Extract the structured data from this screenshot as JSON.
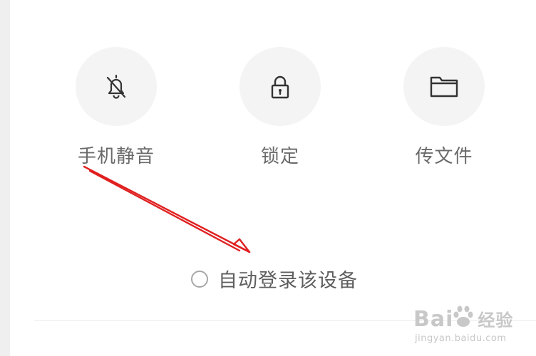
{
  "actions": [
    {
      "label": "手机静音",
      "icon": "bell-off-icon"
    },
    {
      "label": "锁定",
      "icon": "lock-icon"
    },
    {
      "label": "传文件",
      "icon": "folder-icon"
    }
  ],
  "auto_login": {
    "label": "自动登录该设备",
    "checked": false
  },
  "annotation": {
    "arrow_color": "#e02020"
  },
  "watermark": {
    "brand": "Bai",
    "brand_cn": "经验",
    "url": "jingyan.baidu.com"
  }
}
